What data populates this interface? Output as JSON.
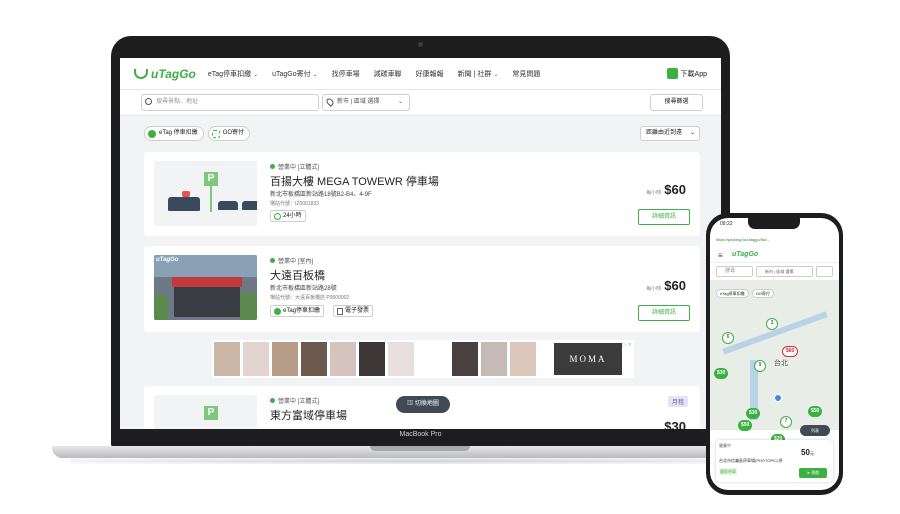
{
  "laptop": {
    "bezel_label": "MacBook Pro",
    "nav": {
      "logo": "uTagGo",
      "items": [
        "eTag停車扣繳",
        "uTagGo寄付",
        "找停車場",
        "減碳車聯",
        "好康報報",
        "新聞 | 社群",
        "常見問題"
      ],
      "has_chevron": [
        true,
        true,
        false,
        false,
        false,
        true,
        false
      ],
      "download": "下載App"
    },
    "search": {
      "placeholder": "搜尋景點、地址",
      "location": "新市 | 區域 選擇",
      "filter": "搜尋篩選"
    },
    "chips": [
      "eTag 停車扣繳",
      "GO寄付"
    ],
    "sort": "距離由近到遠",
    "cards": [
      {
        "status": "營業中 [立體式]",
        "title": "百揚大樓 MEGA TOWEWR 停車場",
        "address": "新北市板橋區新站路18號B2-B4、4-9F",
        "code": "場站代號：IZ0001833",
        "tags": [
          "24小時"
        ],
        "price_unit": "每小時",
        "price": "$60",
        "detail": "詳細資訊"
      },
      {
        "status": "營業中 [室內]",
        "title": "大遠百板橋",
        "address": "新北市板橋區新站路28號",
        "code": "場站代號：大遠百板橋店 P9500002",
        "tags": [
          "eTag停車扣繳",
          "電子發票"
        ],
        "price_unit": "每小時",
        "price": "$60",
        "detail": "詳細資訊",
        "photo_sign": "uTagGo"
      },
      {
        "status": "營業中 [立體式]",
        "title": "東方富域停車場",
        "monthly": "月租",
        "price": "$30"
      }
    ],
    "ad": {
      "brand": "MOMA",
      "mark": "▷ ✕"
    },
    "map_toggle": "切換地圖"
  },
  "phone": {
    "time": "09:22",
    "url": "https://parking.tw/utaggo/list/...",
    "logo": "uTagGo",
    "search_placeholder": "搜尋",
    "location": "新市 | 區域 選擇",
    "chips": [
      "eTag停車扣繳",
      "GO寄付"
    ],
    "map_city": "台北",
    "map_city2": "市",
    "markers": [
      "6",
      "3",
      "$60",
      "9",
      "$30",
      "7",
      "$50",
      "$50",
      "$30",
      "$20",
      "4",
      "7"
    ],
    "list_button": "列表",
    "card": {
      "status": "營業中",
      "name": "台北市信義區停車場(PHOTOPIC)停",
      "badge": "國家停車",
      "price": "50",
      "price_unit": "元",
      "nav_button": "導航"
    }
  }
}
